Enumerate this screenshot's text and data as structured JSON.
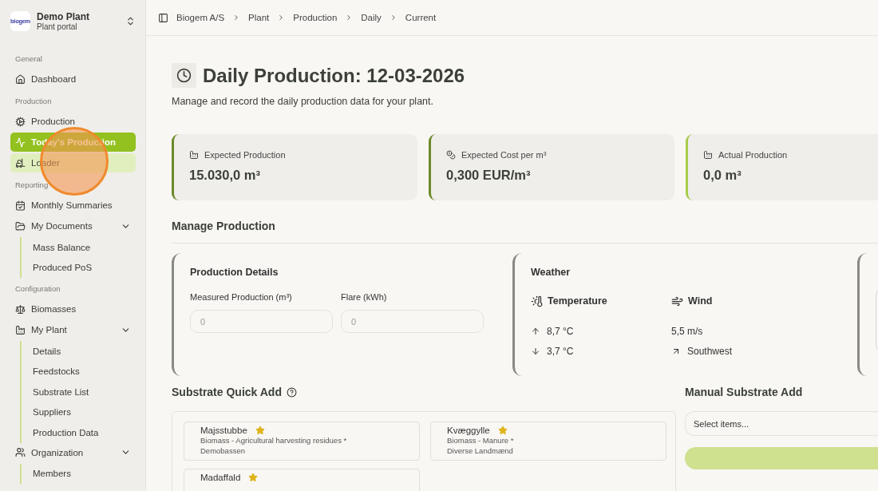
{
  "sidebar": {
    "brand": {
      "logo": "biogem",
      "name": "Demo Plant",
      "subtitle": "Plant portal"
    },
    "sections": [
      {
        "label": "General",
        "items": [
          {
            "label": "Dashboard",
            "selected": false,
            "hovered": false
          }
        ]
      },
      {
        "label": "Production",
        "items": [
          {
            "label": "Production",
            "selected": false,
            "hovered": false
          },
          {
            "label": "Today's Production",
            "selected": true,
            "hovered": false
          },
          {
            "label": "Loader",
            "selected": false,
            "hovered": true
          }
        ]
      },
      {
        "label": "Reporting",
        "items": [
          {
            "label": "Monthly Summaries",
            "selected": false,
            "hovered": false
          },
          {
            "label": "My Documents",
            "selected": false,
            "hovered": false,
            "expanded": true,
            "children": [
              {
                "label": "Mass Balance",
                "selected": false
              },
              {
                "label": "Produced PoS",
                "selected": false
              }
            ]
          }
        ]
      },
      {
        "label": "Configuration",
        "items": [
          {
            "label": "Biomasses",
            "selected": false,
            "hovered": false
          },
          {
            "label": "My Plant",
            "selected": false,
            "hovered": false,
            "expanded": true,
            "children": [
              {
                "label": "Details",
                "selected": false
              },
              {
                "label": "Feedstocks",
                "selected": false
              },
              {
                "label": "Substrate List",
                "selected": false
              },
              {
                "label": "Suppliers",
                "selected": false
              },
              {
                "label": "Production Data",
                "selected": false
              }
            ]
          },
          {
            "label": "Organization",
            "selected": false,
            "hovered": false,
            "expanded": true,
            "children": [
              {
                "label": "Members",
                "selected": false
              }
            ]
          }
        ]
      }
    ]
  },
  "click_indicator": true,
  "breadcrumb": [
    "Biogem A/S",
    "Plant",
    "Production",
    "Daily",
    "Current"
  ],
  "page": {
    "title": "Daily Production: 12-03-2026",
    "subtitle": "Manage and record the daily production data for your plant."
  },
  "stats": [
    {
      "label": "Expected Production",
      "value": "15.030,0 m³",
      "color": "#6b8a2a"
    },
    {
      "label": "Expected Cost per m³",
      "value": "0,300 EUR/m³",
      "color": "#6b8a2a"
    },
    {
      "label": "Actual Production",
      "value": "0,0 m³",
      "color": "#a9cc4a"
    }
  ],
  "manage_heading": "Manage Production",
  "production_details": {
    "title": "Production Details",
    "fields": [
      {
        "label": "Measured Production (m³)",
        "placeholder": "0"
      },
      {
        "label": "Flare (kWh)",
        "placeholder": "0"
      }
    ]
  },
  "weather": {
    "title": "Weather",
    "temperature": {
      "label": "Temperature",
      "high": "8,7 °C",
      "low": "3,7 °C"
    },
    "wind": {
      "label": "Wind",
      "speed": "5,5 m/s",
      "direction": "Southwest"
    }
  },
  "quick_add": {
    "title": "Substrate Quick Add",
    "items": [
      {
        "name": "Majsstubbe",
        "favorite": true,
        "category": "Biomass - Agricultural harvesting residues *",
        "supplier": "Demobassen"
      },
      {
        "name": "Kvæggylle",
        "favorite": true,
        "category": "Biomass - Manure *",
        "supplier": "Diverse Landmænd"
      },
      {
        "name": "Madaffald",
        "favorite": true
      }
    ]
  },
  "manual_add": {
    "title": "Manual Substrate Add",
    "select_placeholder": "Select items..."
  }
}
